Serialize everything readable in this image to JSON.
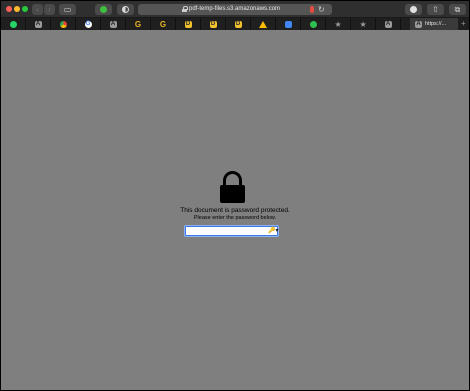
{
  "browser": {
    "url": "pdf-temp-files.s3.amazonaws.com",
    "active_tab_title": "https://...",
    "tab_icons": [
      "whatsapp-icon",
      "a-icon",
      "chrome-icon",
      "google-icon",
      "a-icon",
      "g-icon",
      "g-icon",
      "yellow-doc-icon",
      "yellow-doc-icon",
      "yellow-doc-icon",
      "drive-icon",
      "docs-icon",
      "green-circle-icon",
      "star-icon",
      "star-icon",
      "a-icon"
    ],
    "icons": {
      "back": "‹",
      "forward": "›",
      "reload": "↻",
      "new_tab": "+",
      "share": "⇧",
      "tabs": "⧉",
      "sidebar": "▭",
      "star": "★",
      "key": "🔑▾"
    }
  },
  "page": {
    "title": "This document is password protected.",
    "subtitle": "Please enter the password below.",
    "password_value": ""
  },
  "colors": {
    "background": "#7f7f7f",
    "focus_ring": "#3b78e7"
  }
}
